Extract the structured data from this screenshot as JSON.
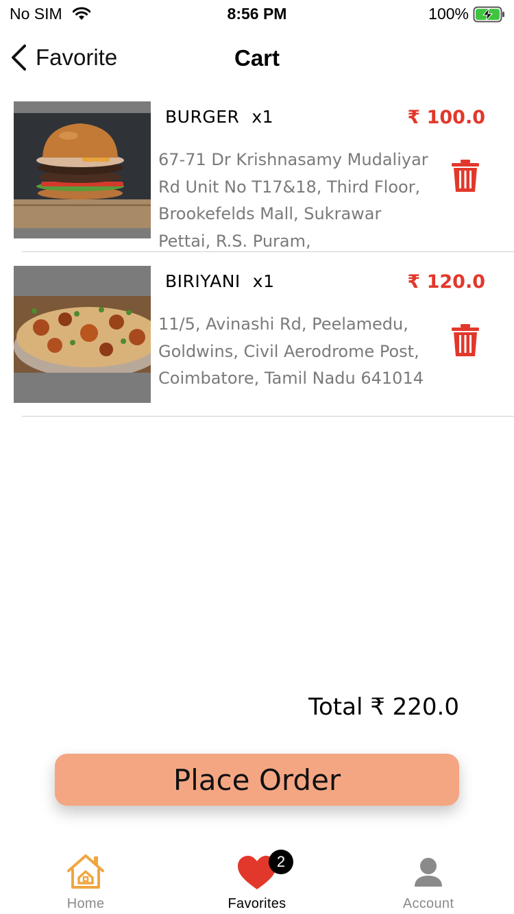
{
  "status_bar": {
    "carrier": "No SIM",
    "time": "8:56 PM",
    "battery": "100%"
  },
  "nav": {
    "back_label": "Favorite",
    "title": "Cart"
  },
  "cart": {
    "items": [
      {
        "name": "BURGER",
        "qty": "x1",
        "price": "₹ 100.0",
        "address": "67-71 Dr Krishnasamy Mudaliyar Rd Unit No T17&18, Third Floor, Brookefelds Mall, Sukrawar Pettai, R.S. Puram,"
      },
      {
        "name": "BIRIYANI",
        "qty": "x1",
        "price": "₹ 120.0",
        "address": "11/5, Avinashi Rd, Peelamedu, Goldwins, Civil Aerodrome Post, Coimbatore, Tamil Nadu 641014"
      }
    ]
  },
  "total_label": "Total ₹ 220.0",
  "place_order_label": "Place Order",
  "tabs": [
    {
      "label": "Home",
      "icon": "home-icon"
    },
    {
      "label": "Favorites",
      "icon": "heart-icon",
      "badge": "2"
    },
    {
      "label": "Account",
      "icon": "person-icon"
    }
  ],
  "colors": {
    "price": "#e2382b",
    "button": "#f4a683",
    "heart": "#e2382b",
    "home": "#f0a640"
  }
}
